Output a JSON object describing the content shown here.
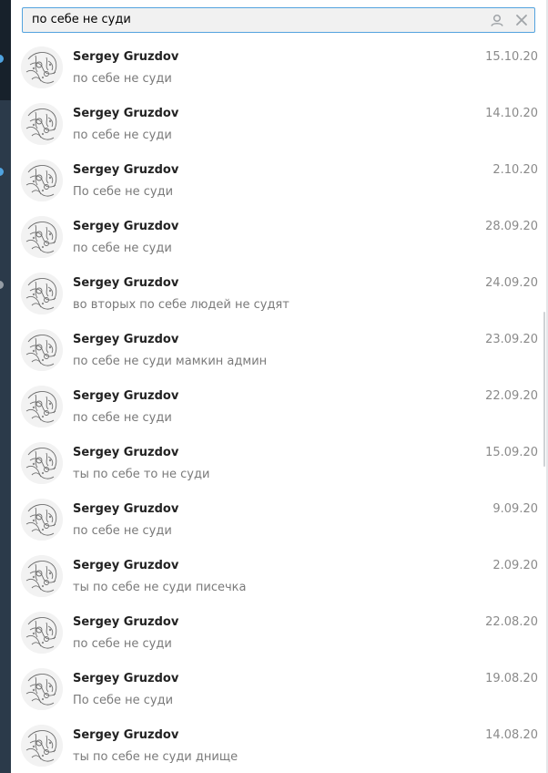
{
  "search": {
    "query": "по себе не суди",
    "clear_icon": "close-icon",
    "from_user_icon": "user-icon"
  },
  "colors": {
    "accent": "#54a3de",
    "sidebar": "#2b3a4a",
    "name_text": "#222222",
    "meta_text": "#8a8a8a"
  },
  "results": [
    {
      "name": "Sergey Gruzdov",
      "date": "15.10.20",
      "text": "по себе не суди"
    },
    {
      "name": "Sergey Gruzdov",
      "date": "14.10.20",
      "text": "по себе не суди"
    },
    {
      "name": "Sergey Gruzdov",
      "date": "2.10.20",
      "text": "По себе не суди"
    },
    {
      "name": "Sergey Gruzdov",
      "date": "28.09.20",
      "text": "по себе не суди"
    },
    {
      "name": "Sergey Gruzdov",
      "date": "24.09.20",
      "text": "во вторых по себе людей не судят"
    },
    {
      "name": "Sergey Gruzdov",
      "date": "23.09.20",
      "text": "по себе не суди мамкин админ"
    },
    {
      "name": "Sergey Gruzdov",
      "date": "22.09.20",
      "text": "по себе не суди"
    },
    {
      "name": "Sergey Gruzdov",
      "date": "15.09.20",
      "text": "ты по себе то не суди"
    },
    {
      "name": "Sergey Gruzdov",
      "date": "9.09.20",
      "text": "по себе не суди"
    },
    {
      "name": "Sergey Gruzdov",
      "date": "2.09.20",
      "text": "ты по себе не суди писечка"
    },
    {
      "name": "Sergey Gruzdov",
      "date": "22.08.20",
      "text": "по себе не суди"
    },
    {
      "name": "Sergey Gruzdov",
      "date": "19.08.20",
      "text": "По себе не суди"
    },
    {
      "name": "Sergey Gruzdov",
      "date": "14.08.20",
      "text": "ты по себе не суди днище"
    }
  ]
}
